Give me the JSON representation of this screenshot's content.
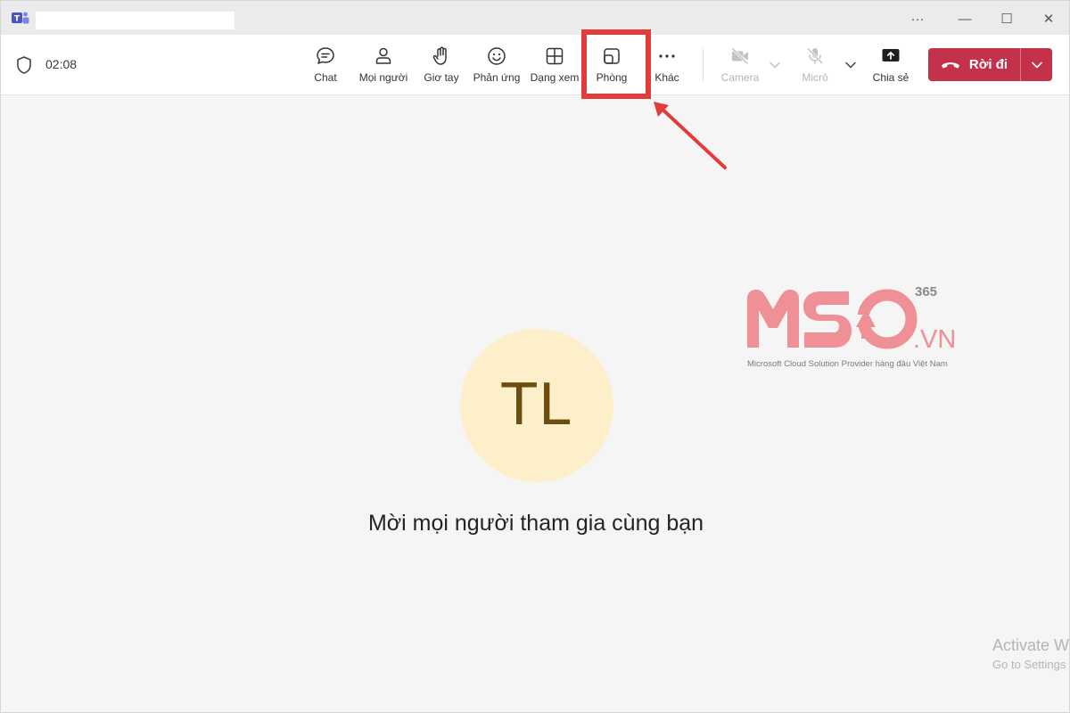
{
  "window": {
    "controls": {
      "more": "···",
      "minimize": "—",
      "maximize": "☐",
      "close": "✕"
    }
  },
  "toolbar": {
    "timer": "02:08",
    "buttons": [
      {
        "id": "chat",
        "label": "Chat",
        "icon": "chat-icon"
      },
      {
        "id": "people",
        "label": "Mọi người",
        "icon": "people-icon"
      },
      {
        "id": "raise-hand",
        "label": "Giơ tay",
        "icon": "hand-icon"
      },
      {
        "id": "react",
        "label": "Phản ứng",
        "icon": "smile-icon"
      },
      {
        "id": "view",
        "label": "Dạng xem",
        "icon": "grid-icon"
      },
      {
        "id": "rooms",
        "label": "Phòng",
        "icon": "rooms-icon"
      },
      {
        "id": "more",
        "label": "Khác",
        "icon": "more-icon"
      },
      {
        "id": "camera",
        "label": "Camera",
        "icon": "camera-off-icon",
        "disabled": true
      },
      {
        "id": "mic",
        "label": "Micrô",
        "icon": "mic-off-icon",
        "disabled": true
      },
      {
        "id": "share",
        "label": "Chia sẻ",
        "icon": "share-icon"
      }
    ],
    "leave_label": "Rời đi"
  },
  "stage": {
    "avatar_initials": "TL",
    "invite_text": "Mời mọi người tham gia cùng bạn"
  },
  "watermark": {
    "brand": "MSO",
    "superscript": "365",
    "domain": ".VN",
    "tagline": "Microsoft Cloud Solution Provider hàng đầu Việt Nam"
  },
  "activation": {
    "line1": "Activate W",
    "line2": "Go to Settings"
  },
  "colors": {
    "leave_button": "#c4314b",
    "highlight": "#e23c3c",
    "avatar_bg": "#fdefc9",
    "avatar_text": "#6d4c0f",
    "watermark": "#ef8f96"
  }
}
